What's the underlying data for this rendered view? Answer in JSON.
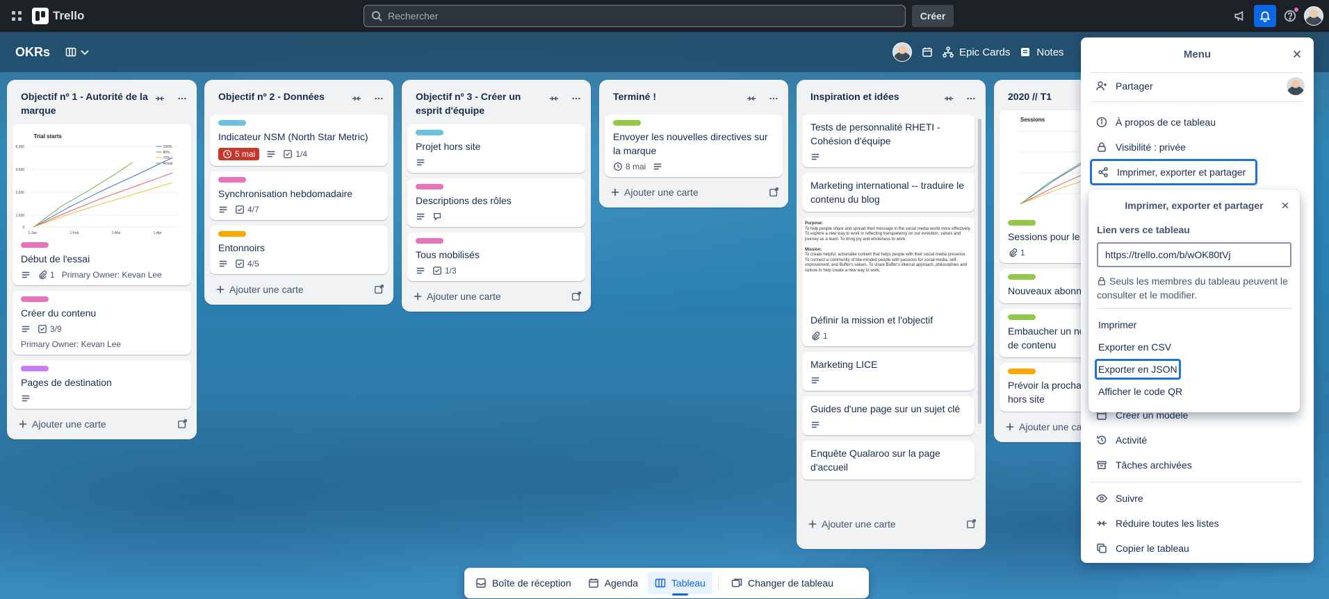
{
  "topbar": {
    "brand": "Trello",
    "search_placeholder": "Rechercher",
    "create_label": "Créer"
  },
  "board": {
    "title": "OKRs",
    "header_items": [
      "Epic Cards",
      "Notes"
    ]
  },
  "lists": [
    {
      "title": "Objectif nº 1 - Autorité de la marque",
      "cards": [
        {
          "label_color": "#e774bb",
          "title": "Début de l'essai",
          "attachments": "1",
          "owner": "Primary Owner: Kevan Lee",
          "cover_title": "Trial starts"
        },
        {
          "label_color": "#e774bb",
          "title": "Créer du contenu",
          "checklist": "3/9",
          "owner": "Primary Owner: Kevan Lee"
        },
        {
          "label_color": "#c97cf4",
          "title": "Pages de destination"
        }
      ],
      "add_card": "Ajouter une carte"
    },
    {
      "title": "Objectif nº 2 - Données",
      "cards": [
        {
          "label_color": "#6cc3e0",
          "title": "Indicateur NSM (North Star Metric)",
          "due": "5 mai",
          "checklist": "1/4"
        },
        {
          "label_color": "#e774bb",
          "title": "Synchronisation hebdomadaire",
          "checklist": "4/7"
        },
        {
          "label_color": "#fca700",
          "title": "Entonnoirs",
          "checklist": "4/5"
        }
      ],
      "add_card": "Ajouter une carte"
    },
    {
      "title": "Objectif nº 3 - Créer un esprit d'équipe",
      "cards": [
        {
          "label_color": "#6cc3e0",
          "title": "Projet hors site"
        },
        {
          "label_color": "#e774bb",
          "title": "Descriptions des rôles"
        },
        {
          "label_color": "#e774bb",
          "title": "Tous mobilisés",
          "checklist": "1/3"
        }
      ],
      "add_card": "Ajouter une carte"
    },
    {
      "title": "Terminé !",
      "cards": [
        {
          "label_color": "#94c748",
          "title": "Envoyer les nouvelles directives sur la marque",
          "date": "8 mai"
        }
      ],
      "add_card": "Ajouter une carte"
    },
    {
      "title": "Inspiration et idées",
      "cards": [
        {
          "title": "Tests de personnalité RHETI - Cohésion d'équipe"
        },
        {
          "title": "Marketing international -- traduire le contenu du blog"
        },
        {
          "title": "Définir la mission et l'objectif",
          "attachments": "1",
          "purpose_heading": "Purpose:",
          "purpose_text": "To help people share and spread their message in the social media world more effectively. To explore a new way to work in reflecting transparency on our evolution, values and journey as a team. To bring joy and wholeness to work.",
          "mission_heading": "Mission:",
          "mission_text": "To create helpful, actionable content that helps people with their social media presence. To connect a community of like-minded people with passions for social media, self-improvement, and Buffer's values. To share Buffer's internal approach, philosophies and culture to help create a new way to work."
        },
        {
          "title": "Marketing LICE"
        },
        {
          "title": "Guides d'une page sur un sujet clé"
        },
        {
          "title": "Enquête Qualaroo sur la page d'accueil"
        }
      ],
      "add_card": "Ajouter une carte"
    },
    {
      "title": "2020 // T1",
      "cards": [
        {
          "label_color": "#94c748",
          "title": "Sessions pour le",
          "attachments": "1",
          "cover_title": "Sessions"
        },
        {
          "label_color": "#94c748",
          "title": "Nouveaux abonnés Instagram"
        },
        {
          "label_color": "#94c748",
          "title": "Embaucher un nouveau distributeur de contenu"
        },
        {
          "label_color": "#fca700",
          "title": "Prévoir la prochaine réunion d'équipe hors site"
        }
      ],
      "add_card": "Ajouter une carte"
    }
  ],
  "menu": {
    "title": "Menu",
    "items": {
      "share": "Partager",
      "about": "À propos de ce tableau",
      "visibility": "Visibilité : privée",
      "print_export": "Imprimer, exporter et partager",
      "template": "Créer un modèle",
      "activity": "Activité",
      "archived": "Tâches archivées",
      "follow": "Suivre",
      "collapse": "Réduire toutes les listes",
      "copy": "Copier le tableau"
    }
  },
  "popover": {
    "title": "Imprimer, exporter et partager",
    "link_label": "Lien vers ce tableau",
    "link_value": "https://trello.com/b/wOK80tVj",
    "note": "Seuls les membres du tableau peuvent le consulter et le modifier.",
    "print": "Imprimer",
    "csv": "Exporter en CSV",
    "json": "Exporter en JSON",
    "qr": "Afficher le code QR"
  },
  "bottom_nav": {
    "inbox": "Boîte de réception",
    "agenda": "Agenda",
    "board": "Tableau",
    "switch": "Changer de tableau"
  },
  "icons": {
    "cover_chart_legend": [
      "100%",
      "80%",
      "70%",
      "Actual"
    ],
    "cover_chart_y_ticks": [
      "6,000",
      "4,500",
      "3,000",
      "1,500",
      "0"
    ],
    "cover_chart_x_ticks": [
      "1-Jan",
      "1-Feb",
      "1-Mar",
      "1-Apr"
    ]
  }
}
